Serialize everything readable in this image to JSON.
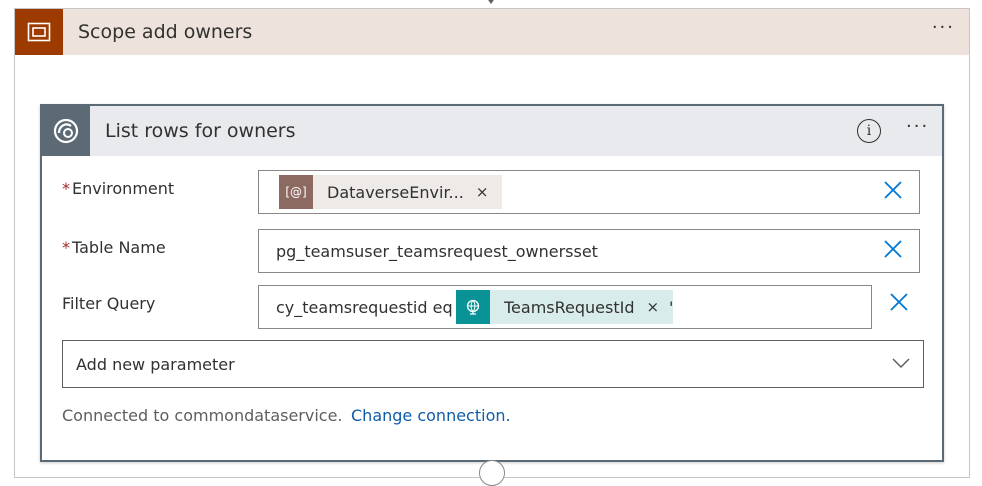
{
  "scope": {
    "title": "Scope add owners",
    "more_label": "···"
  },
  "action": {
    "title": "List rows for owners",
    "info_label": "i",
    "more_label": "···",
    "fields": {
      "environment": {
        "label": "Environment",
        "required_marker": "*",
        "token_icon_text": "[@]",
        "token_label": "DataverseEnvir...",
        "token_remove": "×"
      },
      "table_name": {
        "label": "Table Name",
        "required_marker": "*",
        "value": "pg_teamsuser_teamsrequest_ownersset"
      },
      "filter_query": {
        "label": "Filter Query",
        "value_prefix": "cy_teamsrequestid eq '",
        "token_label": "TeamsRequestId",
        "token_remove": "×",
        "value_suffix": "'"
      }
    },
    "add_parameter": "Add new parameter",
    "connection_text": "Connected to commondataservice.",
    "change_connection": "Change connection."
  },
  "colors": {
    "scope_accent": "#9c3a00",
    "scope_header_bg": "#ede3dc",
    "action_accent": "#5c6a76",
    "variable_token": "#8c6a62",
    "expression_token": "#0a9396",
    "link": "#0f5ca8",
    "clear_x": "#0078d4"
  },
  "icons": {
    "scope": "scope-icon",
    "action": "dataverse-icon",
    "filter_token": "globe-icon",
    "dropdown": "chevron-down-icon",
    "clear": "close-icon"
  }
}
